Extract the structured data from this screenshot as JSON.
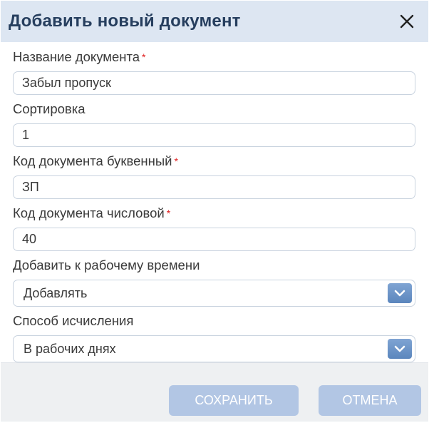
{
  "dialog": {
    "title": "Добавить новый документ",
    "close_icon": "close-icon"
  },
  "fields": {
    "doc_name": {
      "label": "Название документа",
      "required_mark": "*",
      "value": "Забыл пропуск"
    },
    "sort": {
      "label": "Сортировка",
      "value": "1"
    },
    "letter_code": {
      "label": "Код документа буквенный",
      "required_mark": "*",
      "value": "ЗП"
    },
    "number_code": {
      "label": "Код документа числовой",
      "required_mark": "*",
      "value": "40"
    },
    "add_to_worktime": {
      "label": "Добавить к рабочему времени",
      "value": "Добавлять",
      "icon": "chevron-down-icon"
    },
    "calc_method": {
      "label": "Способ исчисления",
      "value": "В рабочих днях",
      "icon": "chevron-down-icon"
    }
  },
  "footer": {
    "save_label": "СОХРАНИТЬ",
    "cancel_label": "ОТМЕНА"
  },
  "colors": {
    "header_bg": "#dde6f2",
    "title": "#263e5e",
    "required": "#e02020",
    "button_bg": "#b2c6e4",
    "select_button": "#5b86bd"
  }
}
